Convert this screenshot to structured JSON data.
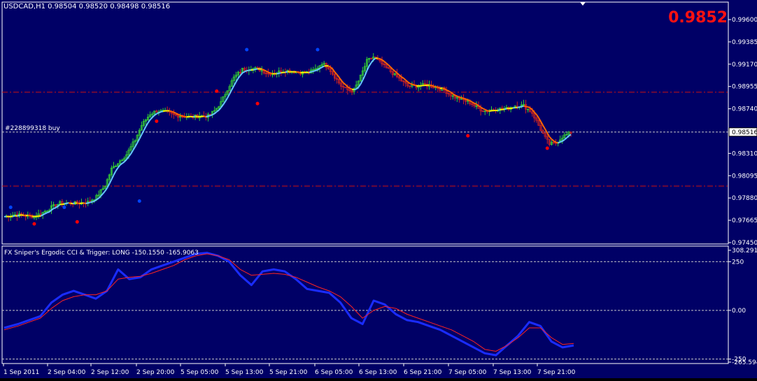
{
  "header": {
    "symbol_line": "USDCAD,H1  0.98504 0.98520 0.98498 0.98516",
    "bid_big": "0.9852"
  },
  "colors": {
    "background": "#000066",
    "frame": "#ffffff",
    "bull_candle": "#33cc33",
    "bear_candle": "#cc2222",
    "level_line": "#cc1111",
    "price_line": "#c8c8c8",
    "bid_big": "#ff1111",
    "ma_colors": [
      "#ffee00",
      "#ff6600",
      "#66c8ff"
    ],
    "dot_high": "#0044ff",
    "dot_low": "#ff0000",
    "cci_line": "#1a2cff",
    "trigger_line": "#ff2222"
  },
  "chart_data": [
    {
      "type": "candlestick",
      "symbol": "USDCAD",
      "timeframe": "H1",
      "ohlc_header": {
        "open": 0.98504,
        "high": 0.9852,
        "low": 0.98498,
        "close": 0.98516
      },
      "current_price_label": "0.98516",
      "ylim": [
        0.9745,
        0.962
      ],
      "y_ticks": [
        "0.99600",
        "0.99385",
        "0.99170",
        "0.98955",
        "0.98740",
        "0.98525",
        "0.98310",
        "0.98095",
        "0.97880",
        "0.97665",
        "0.97450"
      ],
      "x_ticks": [
        "1 Sep 2011",
        "2 Sep 04:00",
        "2 Sep 12:00",
        "2 Sep 20:00",
        "5 Sep 05:00",
        "5 Sep 13:00",
        "5 Sep 21:00",
        "6 Sep 05:00",
        "6 Sep 13:00",
        "6 Sep 21:00",
        "7 Sep 05:00",
        "7 Sep 13:00",
        "7 Sep 21:00"
      ],
      "horizontal_levels": [
        0.989,
        0.97995
      ],
      "order_line": {
        "price": 0.98516,
        "label": "#228899318 buy"
      },
      "close_path": [
        [
          0,
          0.977
        ],
        [
          5,
          0.9772
        ],
        [
          9,
          0.9771
        ],
        [
          14,
          0.977
        ],
        [
          18,
          0.9774
        ],
        [
          22,
          0.9779
        ],
        [
          26,
          0.9783
        ],
        [
          31,
          0.9783
        ],
        [
          35,
          0.9783
        ],
        [
          39,
          0.9784
        ],
        [
          43,
          0.9789
        ],
        [
          47,
          0.98
        ],
        [
          50,
          0.9816
        ],
        [
          54,
          0.9824
        ],
        [
          57,
          0.983
        ],
        [
          61,
          0.9844
        ],
        [
          64,
          0.9858
        ],
        [
          68,
          0.9869
        ],
        [
          71,
          0.9872
        ],
        [
          75,
          0.9871
        ],
        [
          79,
          0.9868
        ],
        [
          83,
          0.9867
        ],
        [
          87,
          0.9866
        ],
        [
          91,
          0.9867
        ],
        [
          95,
          0.9867
        ],
        [
          98,
          0.9872
        ],
        [
          101,
          0.988
        ],
        [
          104,
          0.9893
        ],
        [
          107,
          0.9904
        ],
        [
          111,
          0.9912
        ],
        [
          115,
          0.9913
        ],
        [
          119,
          0.9912
        ],
        [
          123,
          0.9908
        ],
        [
          127,
          0.9909
        ],
        [
          131,
          0.9911
        ],
        [
          135,
          0.991
        ],
        [
          138,
          0.9909
        ],
        [
          142,
          0.9909
        ],
        [
          145,
          0.9912
        ],
        [
          148,
          0.9918
        ],
        [
          151,
          0.9914
        ],
        [
          154,
          0.9905
        ],
        [
          157,
          0.9896
        ],
        [
          160,
          0.9892
        ],
        [
          163,
          0.9892
        ],
        [
          166,
          0.9905
        ],
        [
          169,
          0.992
        ],
        [
          172,
          0.9924
        ],
        [
          176,
          0.9917
        ],
        [
          180,
          0.991
        ],
        [
          184,
          0.9903
        ],
        [
          188,
          0.9896
        ],
        [
          192,
          0.9896
        ],
        [
          196,
          0.9897
        ],
        [
          201,
          0.9895
        ],
        [
          205,
          0.9892
        ],
        [
          209,
          0.9886
        ],
        [
          213,
          0.9883
        ],
        [
          217,
          0.988
        ],
        [
          221,
          0.9874
        ],
        [
          224,
          0.9872
        ],
        [
          227,
          0.9873
        ],
        [
          230,
          0.9874
        ],
        [
          234,
          0.9874
        ],
        [
          238,
          0.9877
        ],
        [
          242,
          0.9877
        ],
        [
          246,
          0.987
        ],
        [
          249,
          0.9858
        ],
        [
          252,
          0.9846
        ],
        [
          254,
          0.984
        ],
        [
          257,
          0.9841
        ],
        [
          260,
          0.9847
        ],
        [
          264,
          0.9851
        ]
      ],
      "bar_count": 264,
      "high_dots": [
        [
          3,
          0.9779
        ],
        [
          28,
          0.9779
        ],
        [
          63,
          0.9785
        ],
        [
          113,
          0.9931
        ],
        [
          146,
          0.9931
        ]
      ],
      "low_dots": [
        [
          14,
          0.9763
        ],
        [
          34,
          0.9765
        ],
        [
          71,
          0.9862
        ],
        [
          99,
          0.9891
        ],
        [
          118,
          0.9879
        ],
        [
          216,
          0.9848
        ],
        [
          253,
          0.9836
        ]
      ]
    },
    {
      "type": "line",
      "title": "FX Sniper's Ergodic CCI & Trigger: LONG -150.1550 -165.9063",
      "ylim": [
        -265.594,
        308.291
      ],
      "y_ticks": [
        "308.291",
        "250",
        "0.00",
        "-250",
        "-265.594"
      ],
      "levels": [
        250,
        0,
        -250
      ],
      "series": [
        {
          "values": [
            [
              0,
              -90
            ],
            [
              5,
              -70
            ],
            [
              9,
              -50
            ],
            [
              13,
              -30
            ],
            [
              17,
              40
            ],
            [
              21,
              80
            ],
            [
              25,
              100
            ],
            [
              29,
              80
            ],
            [
              33,
              60
            ],
            [
              37,
              100
            ],
            [
              41,
              210
            ],
            [
              45,
              160
            ],
            [
              49,
              170
            ],
            [
              53,
              210
            ],
            [
              57,
              230
            ],
            [
              61,
              250
            ],
            [
              65,
              270
            ],
            [
              69,
              290
            ],
            [
              73,
              295
            ],
            [
              77,
              280
            ],
            [
              81,
              250
            ],
            [
              85,
              180
            ],
            [
              89,
              130
            ],
            [
              93,
              200
            ],
            [
              97,
              210
            ],
            [
              101,
              200
            ],
            [
              105,
              160
            ],
            [
              109,
              110
            ],
            [
              113,
              100
            ],
            [
              117,
              90
            ],
            [
              121,
              40
            ],
            [
              125,
              -40
            ],
            [
              129,
              -70
            ],
            [
              133,
              50
            ],
            [
              137,
              30
            ],
            [
              141,
              -20
            ],
            [
              145,
              -50
            ],
            [
              149,
              -60
            ],
            [
              153,
              -80
            ],
            [
              157,
              -100
            ],
            [
              161,
              -130
            ],
            [
              165,
              -160
            ],
            [
              169,
              -190
            ],
            [
              173,
              -220
            ],
            [
              177,
              -230
            ],
            [
              181,
              -180
            ],
            [
              185,
              -130
            ],
            [
              189,
              -60
            ],
            [
              193,
              -80
            ],
            [
              197,
              -160
            ],
            [
              201,
              -190
            ],
            [
              205,
              -180
            ]
          ]
        },
        {
          "values": [
            [
              0,
              -100
            ],
            [
              5,
              -80
            ],
            [
              9,
              -60
            ],
            [
              13,
              -40
            ],
            [
              17,
              10
            ],
            [
              21,
              50
            ],
            [
              25,
              70
            ],
            [
              29,
              80
            ],
            [
              33,
              80
            ],
            [
              37,
              100
            ],
            [
              41,
              160
            ],
            [
              45,
              170
            ],
            [
              49,
              175
            ],
            [
              53,
              190
            ],
            [
              57,
              210
            ],
            [
              61,
              230
            ],
            [
              65,
              260
            ],
            [
              69,
              280
            ],
            [
              73,
              290
            ],
            [
              77,
              280
            ],
            [
              81,
              260
            ],
            [
              85,
              210
            ],
            [
              89,
              180
            ],
            [
              93,
              185
            ],
            [
              97,
              190
            ],
            [
              101,
              185
            ],
            [
              105,
              170
            ],
            [
              109,
              145
            ],
            [
              113,
              120
            ],
            [
              117,
              100
            ],
            [
              121,
              70
            ],
            [
              125,
              20
            ],
            [
              129,
              -40
            ],
            [
              133,
              0
            ],
            [
              137,
              20
            ],
            [
              141,
              10
            ],
            [
              145,
              -20
            ],
            [
              149,
              -40
            ],
            [
              153,
              -60
            ],
            [
              157,
              -80
            ],
            [
              161,
              -100
            ],
            [
              165,
              -130
            ],
            [
              169,
              -160
            ],
            [
              173,
              -200
            ],
            [
              177,
              -210
            ],
            [
              181,
              -180
            ],
            [
              185,
              -140
            ],
            [
              189,
              -90
            ],
            [
              193,
              -90
            ],
            [
              197,
              -140
            ],
            [
              201,
              -175
            ],
            [
              205,
              -170
            ]
          ]
        }
      ]
    }
  ]
}
